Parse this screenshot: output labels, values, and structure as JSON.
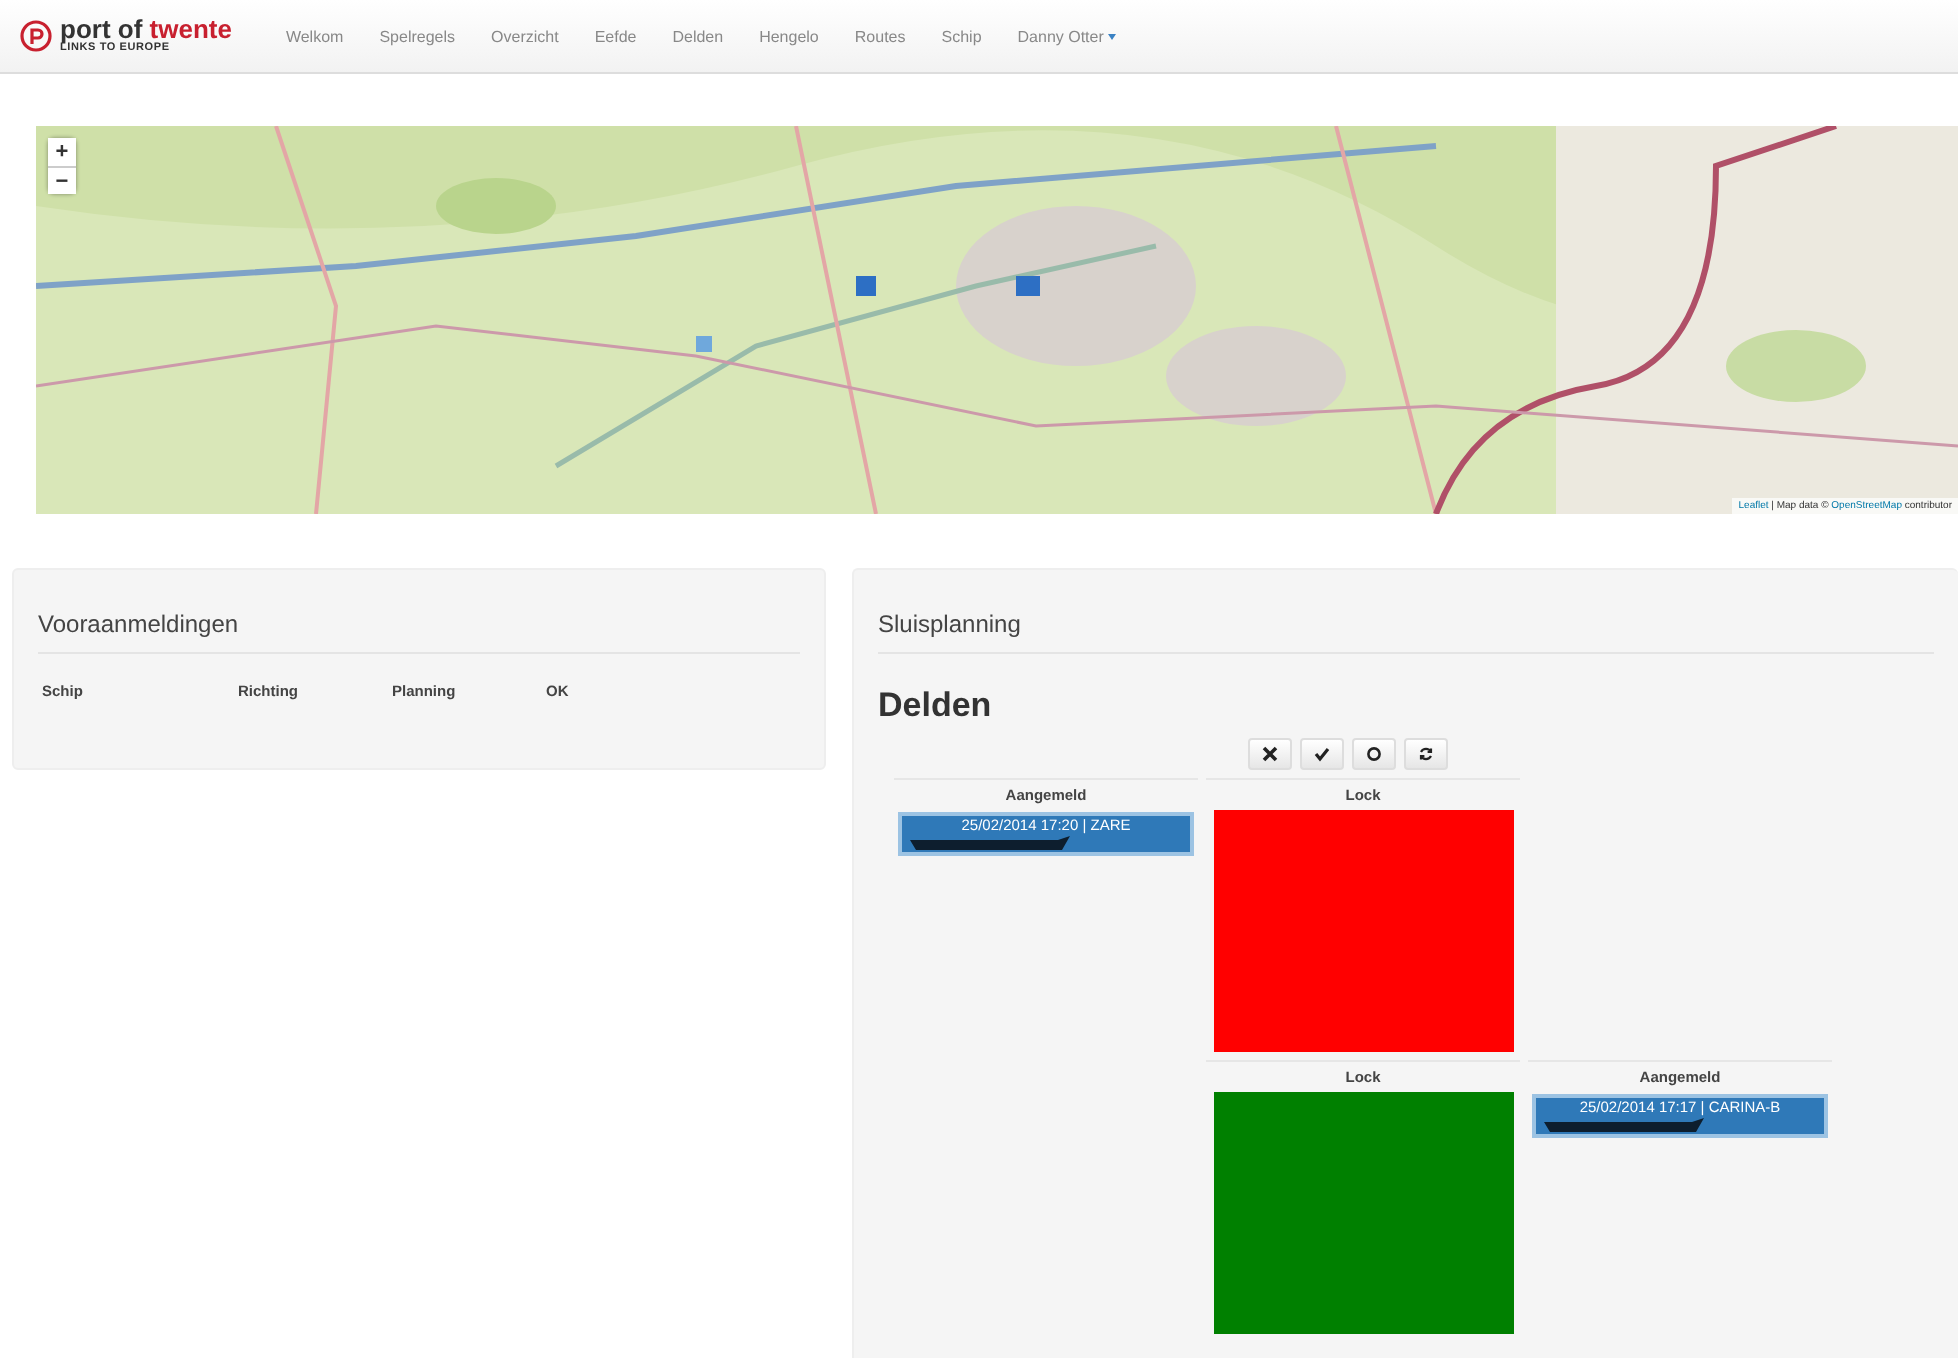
{
  "navbar": {
    "logo": {
      "part_1": "port of",
      "part_2": "twente",
      "tagline": "LINKS TO EUROPE"
    },
    "items": [
      {
        "label": "Welkom"
      },
      {
        "label": "Spelregels"
      },
      {
        "label": "Overzicht"
      },
      {
        "label": "Eefde"
      },
      {
        "label": "Delden"
      },
      {
        "label": "Hengelo"
      },
      {
        "label": "Routes"
      },
      {
        "label": "Schip"
      }
    ],
    "user_menu": {
      "label": "Danny Otter"
    }
  },
  "map": {
    "zoom_in": "+",
    "zoom_out": "−",
    "attribution": {
      "library": "Leaflet",
      "text": "| Map data ©",
      "source": "OpenStreetMap",
      "suffix": "contributor"
    }
  },
  "vooraanmeldingen": {
    "title": "Vooraanmeldingen",
    "columns": [
      "Schip",
      "Richting",
      "Planning",
      "OK"
    ]
  },
  "sluisplanning": {
    "title": "Sluisplanning",
    "lock_name": "Delden",
    "grid": [
      [
        {
          "kind": "queue",
          "header": "Aangemeld",
          "entries": [
            {
              "text": "25/02/2014 17:20 | ZARE"
            }
          ]
        },
        {
          "kind": "lock",
          "header": "Lock",
          "color": "#ff0000"
        },
        {
          "kind": "empty"
        }
      ],
      [
        {
          "kind": "empty"
        },
        {
          "kind": "lock",
          "header": "Lock",
          "color": "#008000"
        },
        {
          "kind": "queue",
          "header": "Aangemeld",
          "entries": [
            {
              "text": "25/02/2014 17:17 | CARINA-B"
            }
          ]
        }
      ]
    ]
  }
}
